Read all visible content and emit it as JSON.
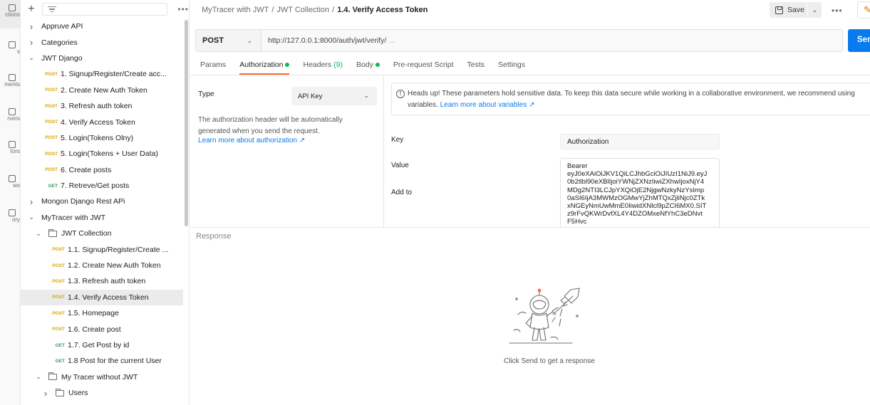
{
  "rail": {
    "items": [
      {
        "label": "ctions",
        "icon": "collections-icon"
      },
      {
        "label": "s",
        "icon": "apis-icon"
      },
      {
        "label": "ments",
        "icon": "environments-icon"
      },
      {
        "label": "rvers",
        "icon": "mock-servers-icon"
      },
      {
        "label": "tors",
        "icon": "monitors-icon"
      },
      {
        "label": "ws",
        "icon": "flows-icon"
      },
      {
        "label": "ory",
        "icon": "history-icon"
      }
    ]
  },
  "sidebar": {
    "tree": [
      {
        "kind": "collection",
        "label": "Appruve API",
        "expanded": false,
        "depth": 0
      },
      {
        "kind": "collection",
        "label": "Categories",
        "expanded": false,
        "depth": 0
      },
      {
        "kind": "collection",
        "label": "JWT Django",
        "expanded": true,
        "depth": 0
      },
      {
        "kind": "request",
        "method": "POST",
        "label": "1. Signup/Register/Create acc...",
        "depth": 1
      },
      {
        "kind": "request",
        "method": "POST",
        "label": "2. Create New Auth Token",
        "depth": 1
      },
      {
        "kind": "request",
        "method": "POST",
        "label": "3. Refresh auth token",
        "depth": 1
      },
      {
        "kind": "request",
        "method": "POST",
        "label": "4. Verify Access Token",
        "depth": 1
      },
      {
        "kind": "request",
        "method": "POST",
        "label": "5. Login(Tokens Olny)",
        "depth": 1
      },
      {
        "kind": "request",
        "method": "POST",
        "label": "5. Login(Tokens + User Data)",
        "depth": 1
      },
      {
        "kind": "request",
        "method": "POST",
        "label": "6. Create posts",
        "depth": 1
      },
      {
        "kind": "request",
        "method": "GET",
        "label": "7. Retreve/Get posts",
        "depth": 1
      },
      {
        "kind": "collection",
        "label": "Mongon Django Rest APi",
        "expanded": false,
        "depth": 0
      },
      {
        "kind": "collection",
        "label": "MyTracer with JWT",
        "expanded": true,
        "depth": 0
      },
      {
        "kind": "folder",
        "label": "JWT Collection",
        "expanded": true,
        "depth": 1
      },
      {
        "kind": "request",
        "method": "POST",
        "label": "1.1. Signup/Register/Create ...",
        "depth": 2
      },
      {
        "kind": "request",
        "method": "POST",
        "label": "1.2. Create New Auth Token",
        "depth": 2
      },
      {
        "kind": "request",
        "method": "POST",
        "label": "1.3. Refresh auth token",
        "depth": 2
      },
      {
        "kind": "request",
        "method": "POST",
        "label": "1.4. Verify Access Token",
        "depth": 2,
        "selected": true
      },
      {
        "kind": "request",
        "method": "POST",
        "label": "1.5. Homepage",
        "depth": 2
      },
      {
        "kind": "request",
        "method": "POST",
        "label": "1.6. Create post",
        "depth": 2
      },
      {
        "kind": "request",
        "method": "GET",
        "label": "1.7. Get Post by id",
        "depth": 2
      },
      {
        "kind": "request",
        "method": "GET",
        "label": "1.8 Post for the current User",
        "depth": 2
      },
      {
        "kind": "folder",
        "label": "My Tracer without JWT",
        "expanded": true,
        "depth": 1
      },
      {
        "kind": "folder",
        "label": "Users",
        "expanded": false,
        "depth": 2
      }
    ]
  },
  "breadcrumb": {
    "collection": "MyTracer with JWT",
    "folder": "JWT Collection",
    "request": "1.4. Verify Access Token",
    "separator": "/"
  },
  "toolbar": {
    "save_label": "Save",
    "more": "•••"
  },
  "request": {
    "method": "POST",
    "url": "http://127.0.0.1:8000/auth/jwt/verify/",
    "url_overflow": "...",
    "send_label": "Sen"
  },
  "tabs": {
    "params": "Params",
    "authorization": "Authorization",
    "headers": "Headers",
    "headers_count": "(9)",
    "body": "Body",
    "prerequest": "Pre-request Script",
    "tests": "Tests",
    "settings": "Settings"
  },
  "auth": {
    "type_label": "Type",
    "type_value": "API Key",
    "description": "The authorization header will be automatically generated when you send the request.",
    "learn_more": "Learn more about authorization ↗",
    "alert_text": "Heads up! These parameters hold sensitive data. To keep this data secure while working in a collaborative environment, we recommend using variables.",
    "alert_link": "Learn more about variables ↗",
    "key_label": "Key",
    "key_value": "Authorization",
    "value_label": "Value",
    "add_to_label": "Add to",
    "value_lines": [
      "Bearer",
      "eyJ0eXAiOiJKV1QiLCJhbGciOiJIUzI1NiJ9.eyJ",
      "0b2tlbl90eXBlIjoiYWNjZXNzIiwiZXhwIjoxNjY4",
      "MDg2NTI3LCJpYXQiOjE2NjgwNzkyNzYsImp",
      "0aSI6IjA3MWMzOGMwYjZhMTQxZjliNjc0ZTk",
      "xNGEyNmUwMmE0IiwidXNlcl9pZCI6MX0.SIT",
      "z9rFvQKWrDvfXL4Y4DZOMxeNfYhC3eDNvt",
      "F5Hvc"
    ]
  },
  "response": {
    "title": "Response",
    "empty_message": "Click Send to get a response"
  },
  "colors": {
    "post": "#d9a400",
    "get": "#2e9e56",
    "accent": "#ff6c37",
    "send": "#097bed",
    "dot": "#0cbb52"
  }
}
